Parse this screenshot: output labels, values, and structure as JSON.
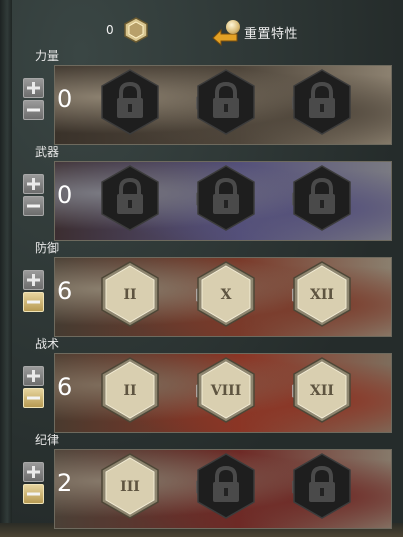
{
  "header": {
    "available_points": "0",
    "reset_label": "重置特性"
  },
  "lines": [
    {
      "title": "力量",
      "points": "0",
      "add_active": false,
      "sub_active": false,
      "traits": [
        {
          "state": "locked",
          "label": ""
        },
        {
          "state": "locked",
          "label": ""
        },
        {
          "state": "locked",
          "label": ""
        }
      ],
      "minors": [
        false,
        false,
        false
      ]
    },
    {
      "title": "武器",
      "points": "0",
      "add_active": false,
      "sub_active": false,
      "traits": [
        {
          "state": "locked",
          "label": ""
        },
        {
          "state": "locked",
          "label": ""
        },
        {
          "state": "locked",
          "label": ""
        }
      ],
      "minors": [
        false,
        false,
        false
      ]
    },
    {
      "title": "防御",
      "points": "6",
      "add_active": false,
      "sub_active": true,
      "traits": [
        {
          "state": "unlocked",
          "label": "II"
        },
        {
          "state": "unlocked",
          "label": "X"
        },
        {
          "state": "unlocked",
          "label": "XII"
        }
      ],
      "minors": [
        true,
        true,
        true
      ]
    },
    {
      "title": "战术",
      "points": "6",
      "add_active": false,
      "sub_active": true,
      "traits": [
        {
          "state": "unlocked",
          "label": "II"
        },
        {
          "state": "unlocked",
          "label": "VIII"
        },
        {
          "state": "unlocked",
          "label": "XII"
        }
      ],
      "minors": [
        true,
        true,
        true
      ]
    },
    {
      "title": "纪律",
      "points": "2",
      "add_active": false,
      "sub_active": true,
      "traits": [
        {
          "state": "unlocked",
          "label": "III"
        },
        {
          "state": "locked",
          "label": ""
        },
        {
          "state": "locked",
          "label": ""
        }
      ],
      "minors": [
        true,
        false,
        false
      ]
    }
  ],
  "colors": {
    "trait_unlocked_fill": "#d9cfb0",
    "trait_unlocked_text": "#5e5440",
    "trait_locked_fill": "#1e1e1e",
    "minor_active": "#ffffff",
    "minor_inactive": "#111111",
    "button_active": "#cdb676"
  }
}
